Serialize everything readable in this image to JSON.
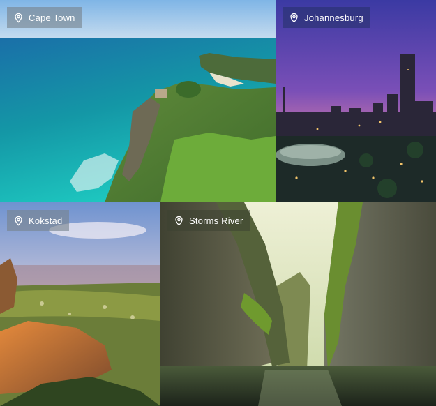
{
  "tiles": [
    {
      "label": "Cape Town",
      "icon": "location-pin-icon"
    },
    {
      "label": "Johannesburg",
      "icon": "location-pin-icon"
    },
    {
      "label": "Kokstad",
      "icon": "location-pin-icon"
    },
    {
      "label": "Storms River",
      "icon": "location-pin-icon"
    }
  ]
}
